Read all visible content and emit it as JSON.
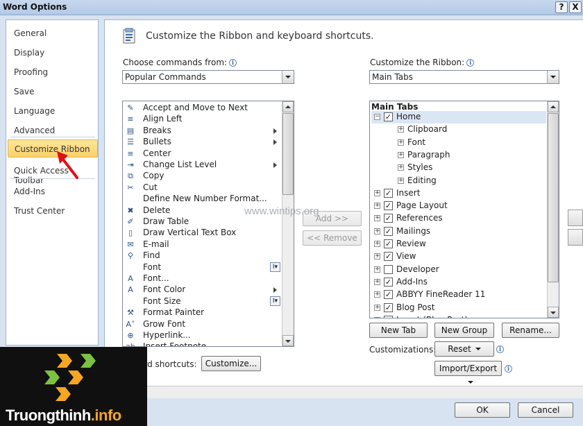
{
  "window": {
    "title": "Word Options",
    "help_glyph": "?",
    "close_glyph": "X"
  },
  "nav": {
    "items": [
      {
        "label": "General"
      },
      {
        "label": "Display"
      },
      {
        "label": "Proofing"
      },
      {
        "label": "Save"
      },
      {
        "label": "Language"
      },
      {
        "label": "Advanced"
      },
      {
        "label": "Customize Ribbon"
      },
      {
        "label": "Quick Access Toolbar"
      },
      {
        "label": "Add-Ins"
      },
      {
        "label": "Trust Center"
      }
    ],
    "selected": "Customize Ribbon"
  },
  "header": {
    "text": "Customize the Ribbon and keyboard shortcuts."
  },
  "left": {
    "label": "Choose commands from:",
    "combo_value": "Popular Commands",
    "commands": [
      {
        "label": "Accept and Move to Next",
        "icon": "✎",
        "marker": ""
      },
      {
        "label": "Align Left",
        "icon": "≡",
        "marker": ""
      },
      {
        "label": "Breaks",
        "icon": "▤",
        "marker": "arrow"
      },
      {
        "label": "Bullets",
        "icon": "☰",
        "marker": "arrow"
      },
      {
        "label": "Center",
        "icon": "≡",
        "marker": ""
      },
      {
        "label": "Change List Level",
        "icon": "⇥",
        "marker": "arrow"
      },
      {
        "label": "Copy",
        "icon": "⧉",
        "marker": ""
      },
      {
        "label": "Cut",
        "icon": "✂",
        "marker": ""
      },
      {
        "label": "Define New Number Format...",
        "icon": "",
        "marker": ""
      },
      {
        "label": "Delete",
        "icon": "✖",
        "marker": ""
      },
      {
        "label": "Draw Table",
        "icon": "✐",
        "marker": ""
      },
      {
        "label": "Draw Vertical Text Box",
        "icon": "▯",
        "marker": ""
      },
      {
        "label": "E-mail",
        "icon": "✉",
        "marker": ""
      },
      {
        "label": "Find",
        "icon": "⚲",
        "marker": ""
      },
      {
        "label": "Font",
        "icon": "",
        "marker": "split"
      },
      {
        "label": "Font...",
        "icon": "A",
        "marker": ""
      },
      {
        "label": "Font Color",
        "icon": "A",
        "marker": "arrow"
      },
      {
        "label": "Font Size",
        "icon": "",
        "marker": "split"
      },
      {
        "label": "Format Painter",
        "icon": "⚒",
        "marker": ""
      },
      {
        "label": "Grow Font",
        "icon": "A˄",
        "marker": ""
      },
      {
        "label": "Hyperlink...",
        "icon": "⊕",
        "marker": ""
      },
      {
        "label": "Insert Footnote",
        "icon": "ab",
        "marker": ""
      }
    ],
    "split_glyph": "I▾"
  },
  "middle": {
    "add_label": "Add >>",
    "remove_label": "<< Remove"
  },
  "right": {
    "label": "Customize the Ribbon:",
    "combo_value": "Main Tabs",
    "tree_header": "Main Tabs",
    "tree": [
      {
        "label": "Home",
        "level": 0,
        "expander": "⊟",
        "checked": true,
        "highlight": true
      },
      {
        "label": "Clipboard",
        "level": 1,
        "expander": "⊞",
        "checked": null
      },
      {
        "label": "Font",
        "level": 1,
        "expander": "⊞",
        "checked": null
      },
      {
        "label": "Paragraph",
        "level": 1,
        "expander": "⊞",
        "checked": null
      },
      {
        "label": "Styles",
        "level": 1,
        "expander": "⊞",
        "checked": null
      },
      {
        "label": "Editing",
        "level": 1,
        "expander": "⊞",
        "checked": null
      },
      {
        "label": "Insert",
        "level": 0,
        "expander": "⊞",
        "checked": true
      },
      {
        "label": "Page Layout",
        "level": 0,
        "expander": "⊞",
        "checked": true
      },
      {
        "label": "References",
        "level": 0,
        "expander": "⊞",
        "checked": true
      },
      {
        "label": "Mailings",
        "level": 0,
        "expander": "⊞",
        "checked": true
      },
      {
        "label": "Review",
        "level": 0,
        "expander": "⊞",
        "checked": true
      },
      {
        "label": "View",
        "level": 0,
        "expander": "⊞",
        "checked": true
      },
      {
        "label": "Developer",
        "level": 0,
        "expander": "⊞",
        "checked": false
      },
      {
        "label": "Add-Ins",
        "level": 0,
        "expander": "⊞",
        "checked": true
      },
      {
        "label": "ABBYY FineReader 11",
        "level": 0,
        "expander": "⊞",
        "checked": true
      },
      {
        "label": "Blog Post",
        "level": 0,
        "expander": "⊞",
        "checked": true
      },
      {
        "label": "Insert (Blog Post)",
        "level": 0,
        "expander": "⊞",
        "checked": true
      }
    ],
    "check_glyph": "✓",
    "new_tab": "New Tab",
    "new_group": "New Group",
    "rename": "Rename...",
    "customizations_label": "Customizations:",
    "reset": "Reset",
    "import_export": "Import/Export"
  },
  "shortcuts": {
    "label": "ard shortcuts:",
    "button": "Customize..."
  },
  "footer": {
    "ok": "OK",
    "cancel": "Cancel"
  },
  "watermark": "www.wintips.org",
  "logo": {
    "text_main": "Truongthinh",
    "text_accent": ".info"
  },
  "colors": {
    "nav_selected": "#fbd16a",
    "frame": "#d8e3f1",
    "logo_orange": "#f5a623",
    "logo_green": "#7cc242"
  }
}
